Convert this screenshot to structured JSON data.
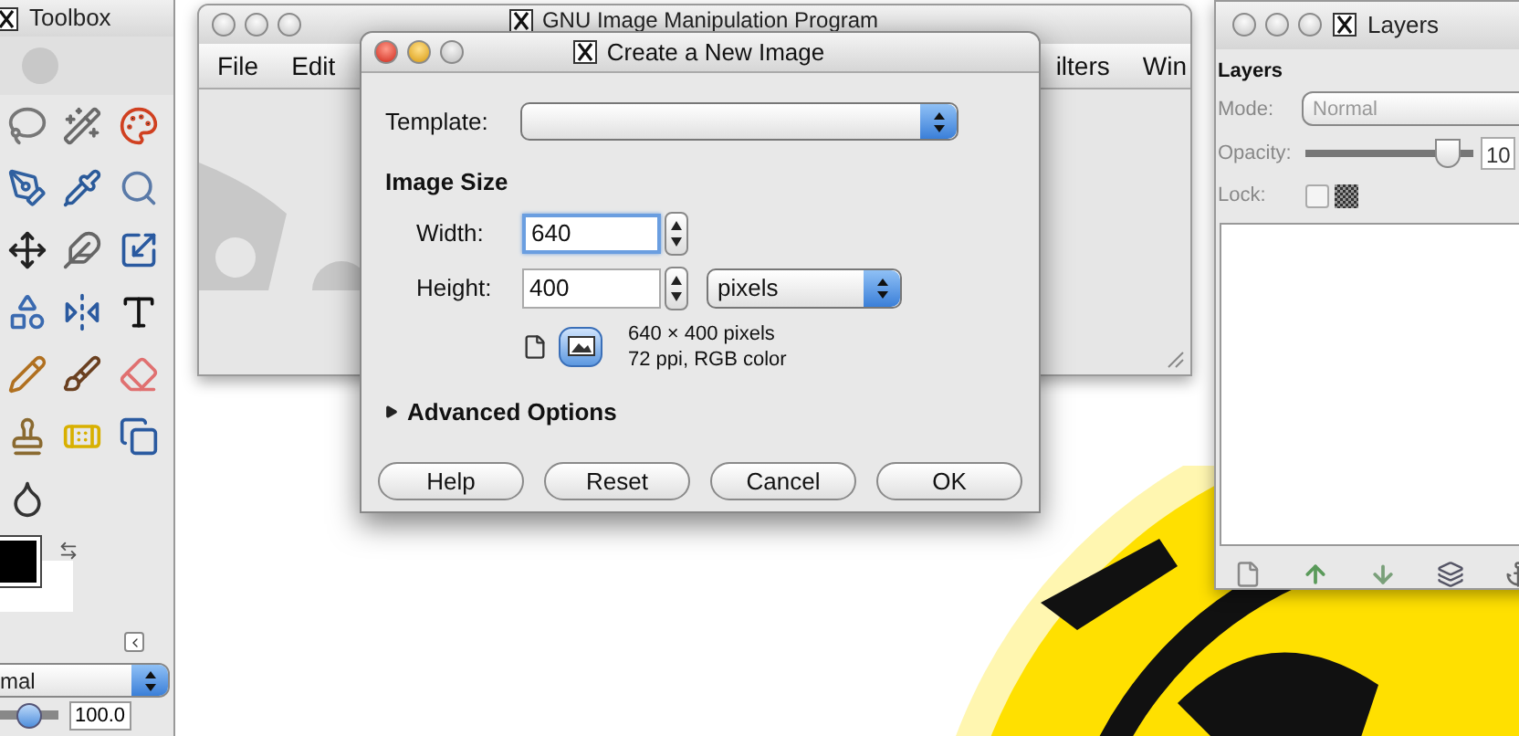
{
  "toolbox": {
    "title": "Toolbox",
    "mode_dropdown": {
      "value": "mal"
    },
    "opacity": {
      "value": "100.0",
      "level": 0.55
    }
  },
  "main_window": {
    "title": "GNU Image Manipulation Program",
    "menu": [
      "File",
      "Edit",
      "ilters",
      "Win"
    ]
  },
  "dialog": {
    "title": "Create a New Image",
    "template": {
      "label": "Template:"
    },
    "image_size": {
      "heading": "Image Size",
      "width": {
        "label": "Width:",
        "value": "640",
        "focused": true
      },
      "height": {
        "label": "Height:",
        "value": "400",
        "focused": false
      },
      "unit": "pixels",
      "orientation": [
        {
          "kind": "portrait",
          "selected": false
        },
        {
          "kind": "landscape",
          "selected": true
        }
      ],
      "info": [
        "640 × 400 pixels",
        "72 ppi, RGB color"
      ]
    },
    "advanced": {
      "label": "Advanced Options",
      "expanded": false
    },
    "buttons": [
      "Help",
      "Reset",
      "Cancel",
      "OK"
    ]
  },
  "layers": {
    "title": "Layers",
    "heading": "Layers",
    "mode": {
      "label": "Mode:",
      "value": "Normal"
    },
    "opacity": {
      "label": "Opacity:",
      "level": 0.85,
      "value": "10"
    },
    "lock": {
      "label": "Lock:",
      "checked": false
    }
  }
}
